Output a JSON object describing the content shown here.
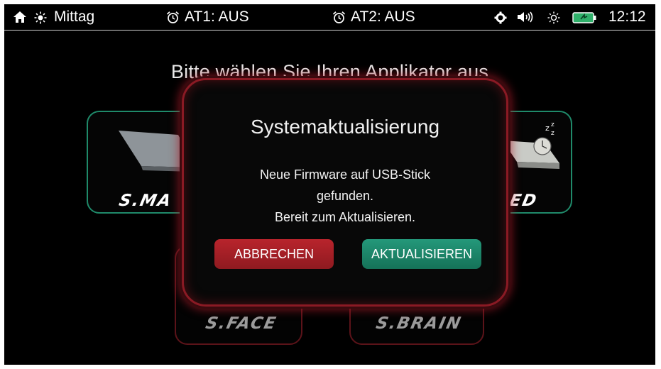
{
  "status_bar": {
    "mode_label": "Mittag",
    "alarm1": "AT1: AUS",
    "alarm2": "AT2: AUS",
    "time": "12:12",
    "icons": [
      "home-icon",
      "sun-icon",
      "alarm-clock-icon",
      "settings-icon",
      "speaker-icon",
      "brightness-icon",
      "battery-icon"
    ]
  },
  "main": {
    "title": "Bitte wählen Sie Ihren Applikator aus",
    "cards": [
      {
        "label": "S.MA",
        "color": "#1f8a6a"
      },
      {
        "label": "ED",
        "color": "#1f8a6a"
      },
      {
        "label": "S.FACE",
        "color": "#7a1a22"
      },
      {
        "label": "S.BRAIN",
        "color": "#7a1a22"
      }
    ]
  },
  "dialog": {
    "title": "Systemaktualisierung",
    "message_lines": [
      "Neue Firmware auf USB-Stick",
      "gefunden.",
      "Bereit zum Aktualisieren."
    ],
    "cancel_label": "ABBRECHEN",
    "update_label": "AKTUALISIEREN",
    "cancel_color": "#b8242c",
    "update_color": "#1f8a6a"
  }
}
